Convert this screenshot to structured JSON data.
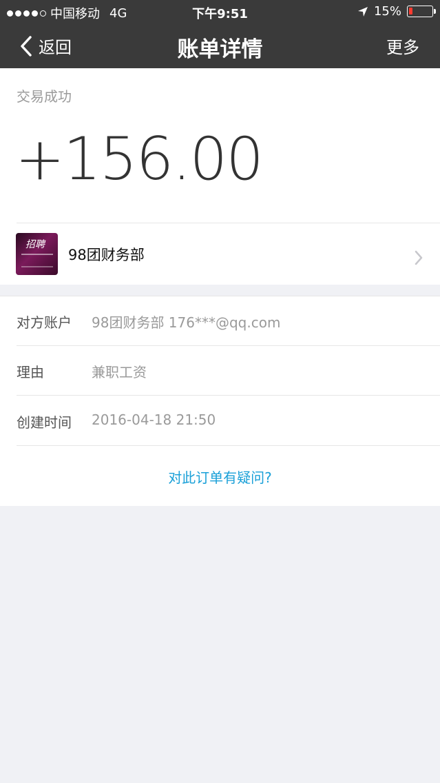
{
  "status_bar": {
    "carrier": "中国移动",
    "network": "4G",
    "time": "下午9:51",
    "battery_text": "15%",
    "battery_level": 0.15
  },
  "nav": {
    "back_label": "返回",
    "title": "账单详情",
    "more_label": "更多"
  },
  "summary": {
    "status": "交易成功",
    "amount": "+156.00"
  },
  "merchant": {
    "name": "98团财务部",
    "avatar_text": "招聘"
  },
  "details": [
    {
      "label": "对方账户",
      "value": "98团财务部 176***@qq.com"
    },
    {
      "label": "理由",
      "value": "兼职工资"
    },
    {
      "label": "创建时间",
      "value": "2016-04-18 21:50"
    }
  ],
  "question_link": "对此订单有疑问?",
  "colors": {
    "navbar": "#3a3a3a",
    "link": "#1aa0d8",
    "background": "#f0f1f5",
    "battery_low": "#ff3b30"
  }
}
